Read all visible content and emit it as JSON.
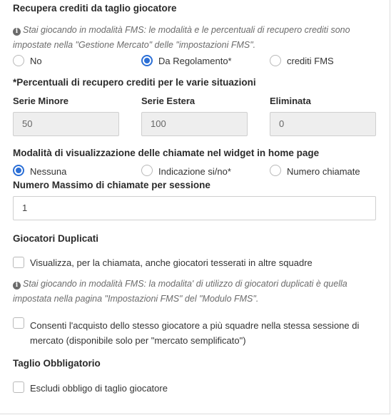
{
  "recupero": {
    "heading": "Recupera crediti da taglio giocatore",
    "note_line1": "Stai giocando in modalità FMS: le modalità e le percentuali di recupero crediti sono",
    "note_line2": "impostate nella \"Gestione Mercato\" delle \"impostazioni FMS\".",
    "options": [
      {
        "label": "No",
        "selected": false
      },
      {
        "label": "Da Regolamento*",
        "selected": true
      },
      {
        "label": "crediti FMS",
        "selected": false
      }
    ]
  },
  "percentuali": {
    "heading": "*Percentuali di recupero crediti per le varie situazioni",
    "fields": [
      {
        "label": "Serie Minore",
        "value": "50"
      },
      {
        "label": "Serie Estera",
        "value": "100"
      },
      {
        "label": "Eliminata",
        "value": "0"
      }
    ]
  },
  "visualizzazione": {
    "heading": "Modalità di visualizzazione delle chiamate nel widget in home page",
    "options": [
      {
        "label": "Nessuna",
        "selected": true
      },
      {
        "label": "Indicazione si/no*",
        "selected": false
      },
      {
        "label": "Numero chiamate",
        "selected": false
      }
    ]
  },
  "max_chiamate": {
    "label": "Numero Massimo di chiamate per sessione",
    "value": "1"
  },
  "duplicati": {
    "heading": "Giocatori Duplicati",
    "checkbox1": "Visualizza, per la chiamata, anche giocatori tesserati in altre squadre",
    "note_line1": "Stai giocando in modalità FMS: la modalita' di utilizzo di giocatori duplicati è quella",
    "note_line2": "impostata nella pagina \"Impostazioni FMS\" del \"Modulo FMS\".",
    "checkbox2_line1": "Consenti l'acquisto dello stesso giocatore a più squadre nella stessa sessione di",
    "checkbox2_line2": "mercato (disponibile solo per \"mercato semplificato\")"
  },
  "taglio": {
    "heading": "Taglio Obbligatorio",
    "checkbox": "Escludi obbligo di taglio giocatore"
  },
  "colors": {
    "accent": "#2b6fd6",
    "disabled_bg": "#eeeeee"
  }
}
